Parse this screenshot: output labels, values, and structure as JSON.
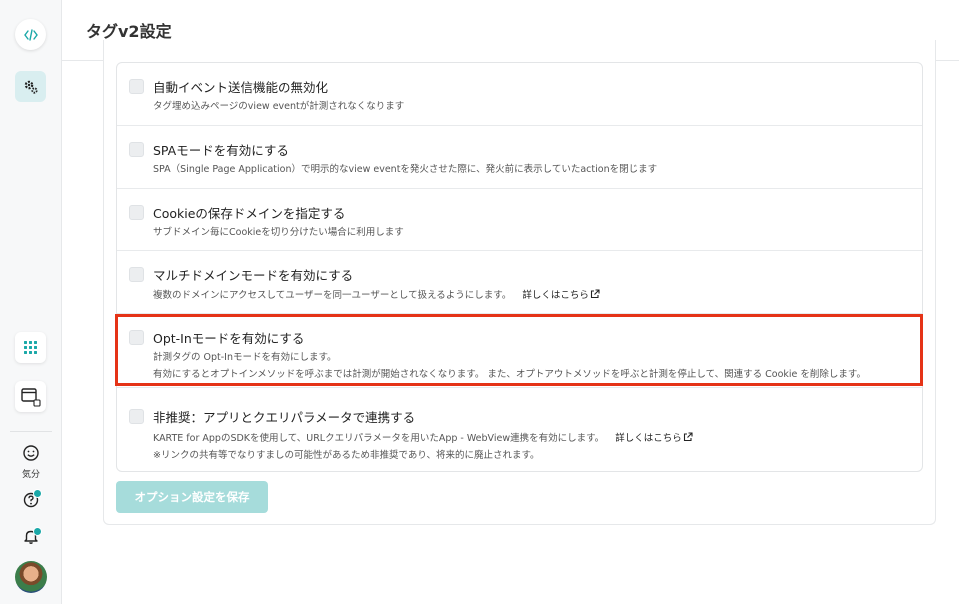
{
  "page": {
    "title": "タグv2設定"
  },
  "sidebar": {
    "mood_label": "気分"
  },
  "options": [
    {
      "title": "自動イベント送信機能の無効化",
      "desc1": "タグ埋め込みページのview eventが計測されなくなります"
    },
    {
      "title": "SPAモードを有効にする",
      "desc1": "SPA（Single Page Application）で明示的なview eventを発火させた際に、発火前に表示していたactionを閉じます"
    },
    {
      "title": "Cookieの保存ドメインを指定する",
      "desc1": "サブドメイン毎にCookieを切り分けたい場合に利用します"
    },
    {
      "title": "マルチドメインモードを有効にする",
      "desc1": "複数のドメインにアクセスしてユーザーを同一ユーザーとして扱えるようにします。",
      "link": "詳しくはこちら"
    },
    {
      "title": "Opt-Inモードを有効にする",
      "desc1": "計測タグの Opt-Inモードを有効にします。",
      "desc2": "有効にするとオプトインメソッドを呼ぶまでは計測が開始されなくなります。 また、オプトアウトメソッドを呼ぶと計測を停止して、関連する Cookie を削除します。"
    },
    {
      "title": "非推奨：アプリとクエリパラメータで連携する",
      "desc1": "KARTE for AppのSDKを使用して、URLクエリパラメータを用いたApp - WebView連携を有効にします。",
      "link": "詳しくはこちら",
      "desc2": "※リンクの共有等でなりすましの可能性があるため非推奨であり、将来的に廃止されます。"
    }
  ],
  "save_button": "オプション設定を保存",
  "colors": {
    "accent": "#1aa8a8",
    "highlight": "#e53317",
    "save_button_bg": "#a6dcdb"
  }
}
